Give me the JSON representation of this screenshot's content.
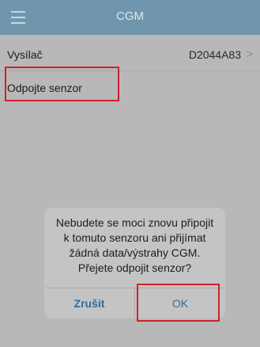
{
  "header": {
    "title": "CGM",
    "menu_icon": "hamburger-menu-icon"
  },
  "settings": {
    "transmitter": {
      "label": "Vysílač",
      "value": "D2044A83",
      "chevron": ">"
    },
    "disconnect": {
      "label": "Odpojte senzor"
    }
  },
  "dialog": {
    "message": "Nebudete se moci znovu připojit k tomuto senzoru ani přijímat žádná data/výstrahy CGM. Přejete odpojit senzor?",
    "cancel_label": "Zrušit",
    "ok_label": "OK"
  },
  "colors": {
    "header_bg": "#6f96ac",
    "dim_bg": "#b8b8b8",
    "dialog_bg": "#c4c4c4",
    "button_text": "#2f6c9b",
    "highlight": "#d0202a"
  }
}
